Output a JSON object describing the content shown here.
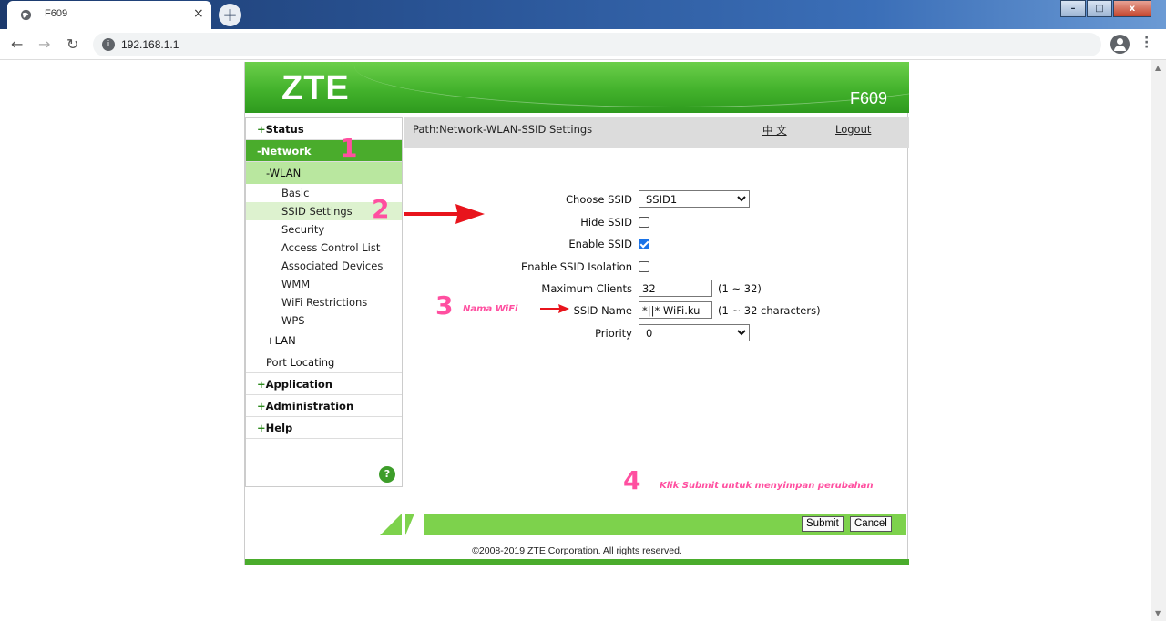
{
  "browser": {
    "tab_title": "F609",
    "tab_close": "×",
    "new_tab": "+",
    "url": "192.168.1.1",
    "win_min": "–",
    "win_max": "□",
    "win_close": "x"
  },
  "router": {
    "brand": "ZTE",
    "model": "F609",
    "menu": {
      "status": "Status",
      "network": "-Network",
      "wlan": "-WLAN",
      "wlan_items": [
        "Basic",
        "SSID Settings",
        "Security",
        "Access Control List",
        "Associated Devices",
        "WMM",
        "WiFi Restrictions",
        "WPS"
      ],
      "lan": "+LAN",
      "port_locating": "Port Locating",
      "application": "Application",
      "administration": "Administration",
      "help": "Help",
      "plus": "+"
    },
    "help_icon": "?",
    "path": "Path:Network-WLAN-SSID Settings",
    "lang_link": "中 文",
    "logout": "Logout",
    "form": {
      "choose_ssid_label": "Choose SSID",
      "choose_ssid_value": "SSID1",
      "hide_ssid_label": "Hide SSID",
      "hide_ssid_checked": false,
      "enable_ssid_label": "Enable SSID",
      "enable_ssid_checked": true,
      "isolation_label": "Enable SSID Isolation",
      "isolation_checked": false,
      "max_clients_label": "Maximum Clients",
      "max_clients_value": "32",
      "max_clients_hint": "(1 ~ 32)",
      "ssid_name_label": "SSID Name",
      "ssid_name_value": "*||* WiFi.ku",
      "ssid_name_hint": "(1 ~ 32 characters)",
      "priority_label": "Priority",
      "priority_value": "0"
    },
    "submit": "Submit",
    "cancel": "Cancel",
    "copyright": "©2008-2019 ZTE Corporation. All rights reserved."
  },
  "annotations": {
    "n1": "1",
    "n2": "2",
    "n3": "3",
    "n3_text": "Nama WiFi",
    "n4": "4",
    "n4_text": "Klik Submit untuk menyimpan perubahan",
    "arrow_color": "#e8141c",
    "text_color": "#ff4fa0"
  }
}
